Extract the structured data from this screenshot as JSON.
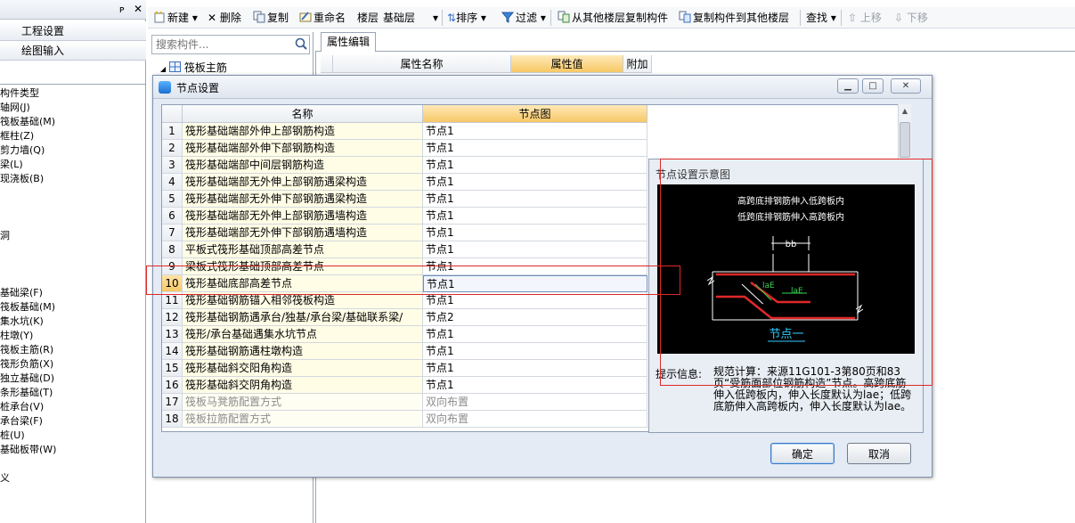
{
  "left_nav": {
    "buttons": [
      "工程设置",
      "绘图输入"
    ],
    "tree_items": [
      "构件类型",
      "轴网(J)",
      "筏板基础(M)",
      "框柱(Z)",
      "剪力墙(Q)",
      "梁(L)",
      "现浇板(B)",
      "洞",
      "基础梁(F)",
      "筏板基础(M)",
      "集水坑(K)",
      "柱墩(Y)",
      "筏板主筋(R)",
      "筏形负筋(X)",
      "独立基础(D)",
      "条形基础(T)",
      "桩承台(V)",
      "承台梁(F)",
      "桩(U)",
      "基础板带(W)",
      "义"
    ]
  },
  "toolbar": {
    "new": "新建",
    "delete": "删除",
    "copy": "复制",
    "rename": "重命名",
    "floor_label": "楼层",
    "floor_value": "基础层",
    "sort": "排序",
    "filter": "过滤",
    "copy_from_floor": "从其他楼层复制构件",
    "copy_to_floor": "复制构件到其他楼层",
    "find": "查找",
    "move_up": "上移",
    "move_down": "下移"
  },
  "component_list": {
    "search_placeholder": "搜索构件...",
    "item": "筏板主筋"
  },
  "properties": {
    "tab": "属性编辑",
    "col_name": "属性名称",
    "col_value": "属性值",
    "col_extra": "附加"
  },
  "dialog": {
    "title": "节点设置",
    "col_name": "名称",
    "col_node": "节点图",
    "rows": [
      {
        "no": "1",
        "name": "筏形基础端部外伸上部钢筋构造",
        "node": "节点1"
      },
      {
        "no": "2",
        "name": "筏形基础端部外伸下部钢筋构造",
        "node": "节点1"
      },
      {
        "no": "3",
        "name": "筏形基础端部中间层钢筋构造",
        "node": "节点1"
      },
      {
        "no": "4",
        "name": "筏形基础端部无外伸上部钢筋遇梁构造",
        "node": "节点1"
      },
      {
        "no": "5",
        "name": "筏形基础端部无外伸下部钢筋遇梁构造",
        "node": "节点1"
      },
      {
        "no": "6",
        "name": "筏形基础端部无外伸上部钢筋遇墙构造",
        "node": "节点1"
      },
      {
        "no": "7",
        "name": "筏形基础端部无外伸下部钢筋遇墙构造",
        "node": "节点1"
      },
      {
        "no": "8",
        "name": "平板式筏形基础顶部高差节点",
        "node": "节点1"
      },
      {
        "no": "9",
        "name": "梁板式筏形基础顶部高差节点",
        "node": "节点1"
      },
      {
        "no": "10",
        "name": "筏形基础底部高差节点",
        "node": "节点1"
      },
      {
        "no": "11",
        "name": "筏形基础钢筋锚入相邻筏板构造",
        "node": "节点1"
      },
      {
        "no": "12",
        "name": "筏形基础钢筋遇承台/独基/承台梁/基础联系梁/",
        "node": "节点2"
      },
      {
        "no": "13",
        "name": "筏形/承台基础遇集水坑节点",
        "node": "节点1"
      },
      {
        "no": "14",
        "name": "筏形基础钢筋遇柱墩构造",
        "node": "节点1"
      },
      {
        "no": "15",
        "name": "筏形基础斜交阳角构造",
        "node": "节点1"
      },
      {
        "no": "16",
        "name": "筏形基础斜交阴角构造",
        "node": "节点1"
      },
      {
        "no": "17",
        "name": "筏板马凳筋配置方式",
        "node": "双向布置"
      },
      {
        "no": "18",
        "name": "筏板拉筋配置方式",
        "node": "双向布置"
      }
    ],
    "preview_title": "节点设置示意图",
    "diagram": {
      "line1": "高跨底排钢筋伸入低跨板内",
      "line2": "低跨底排钢筋伸入高跨板内",
      "bb": "bb",
      "lae1": "laE",
      "lae2": "laE",
      "caption": "节点一"
    },
    "hint_label": "提示信息:",
    "hint_text": "规范计算：来源11G101-3第80页和83页“受筋面部位钢筋构造”节点。高跨底筋伸入低跨板内，伸入长度默认为lae；低跨底筋伸入高跨板内，伸入长度默认为lae。",
    "ok": "确定",
    "cancel": "取消"
  },
  "colors": {
    "accent_header": "#f7c866",
    "annotation_red": "#e02828",
    "diagram_bg": "#000000"
  }
}
